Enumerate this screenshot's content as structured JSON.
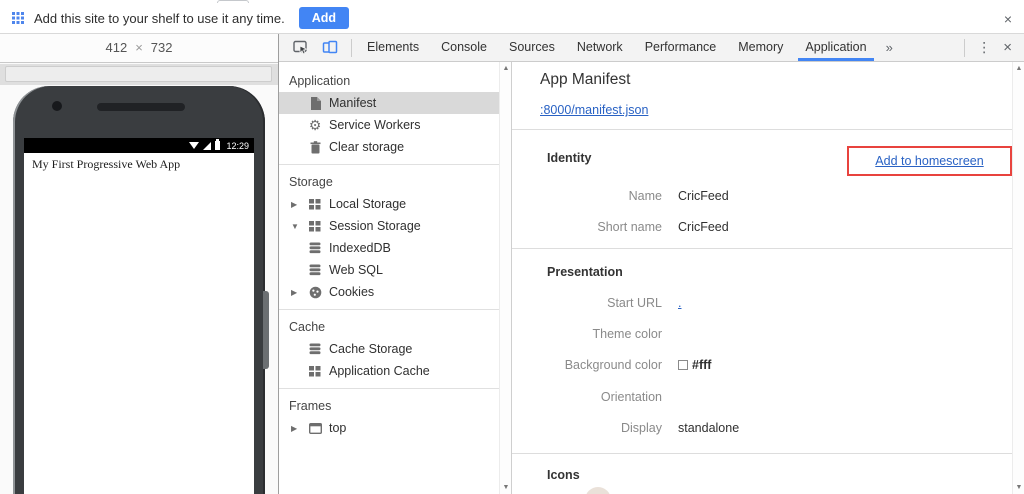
{
  "infobar": {
    "message": "Add this site to your shelf to use it any time.",
    "add_button": "Add",
    "close": "×"
  },
  "device_bar": {
    "width": "412",
    "separator": "×",
    "height": "732"
  },
  "devtools_toolbar": {
    "tabs": [
      {
        "label": "Elements"
      },
      {
        "label": "Console"
      },
      {
        "label": "Sources"
      },
      {
        "label": "Network"
      },
      {
        "label": "Performance"
      },
      {
        "label": "Memory"
      },
      {
        "label": "Application"
      }
    ],
    "active_tab": "Application",
    "overflow_chevron": "»",
    "menu_glyph": "⋮",
    "close_glyph": "×"
  },
  "sidebar": {
    "sections": [
      {
        "title": "Application",
        "items": [
          {
            "label": "Manifest",
            "icon": "document-icon",
            "arrow": "",
            "selected": true
          },
          {
            "label": "Service Workers",
            "icon": "gear-icon",
            "arrow": ""
          },
          {
            "label": "Clear storage",
            "icon": "trash-icon",
            "arrow": ""
          }
        ]
      },
      {
        "title": "Storage",
        "items": [
          {
            "label": "Local Storage",
            "icon": "table-icon",
            "arrow": "▶"
          },
          {
            "label": "Session Storage",
            "icon": "table-icon",
            "arrow": "▼"
          },
          {
            "label": "IndexedDB",
            "icon": "database-icon",
            "arrow": ""
          },
          {
            "label": "Web SQL",
            "icon": "database-icon",
            "arrow": ""
          },
          {
            "label": "Cookies",
            "icon": "cookie-icon",
            "arrow": "▶"
          }
        ]
      },
      {
        "title": "Cache",
        "items": [
          {
            "label": "Cache Storage",
            "icon": "database-icon",
            "arrow": ""
          },
          {
            "label": "Application Cache",
            "icon": "table-icon",
            "arrow": ""
          }
        ]
      },
      {
        "title": "Frames",
        "items": [
          {
            "label": "top",
            "icon": "frame-icon",
            "arrow": "▶"
          }
        ]
      }
    ]
  },
  "manifest": {
    "title": "App Manifest",
    "file_link": ":8000/manifest.json",
    "identity": {
      "header": "Identity",
      "action_link": "Add to homescreen",
      "name_label": "Name",
      "name_value": "CricFeed",
      "short_name_label": "Short name",
      "short_name_value": "CricFeed"
    },
    "presentation": {
      "header": "Presentation",
      "start_url_label": "Start URL",
      "start_url_value": ".",
      "theme_color_label": "Theme color",
      "theme_color_value": "",
      "background_color_label": "Background color",
      "background_color_value": "#fff",
      "orientation_label": "Orientation",
      "orientation_value": "",
      "display_label": "Display",
      "display_value": "standalone"
    },
    "icons_header": "Icons"
  },
  "phone": {
    "status_time": "12:29",
    "page_title": "My First Progressive Web App"
  },
  "scroll": {
    "up": "▲",
    "down": "▼"
  },
  "colors": {
    "accent_blue": "#4285f4",
    "link_blue": "#2962c4",
    "annotation_red": "#e8433e",
    "selected_row_gray": "#d9d9d9"
  }
}
